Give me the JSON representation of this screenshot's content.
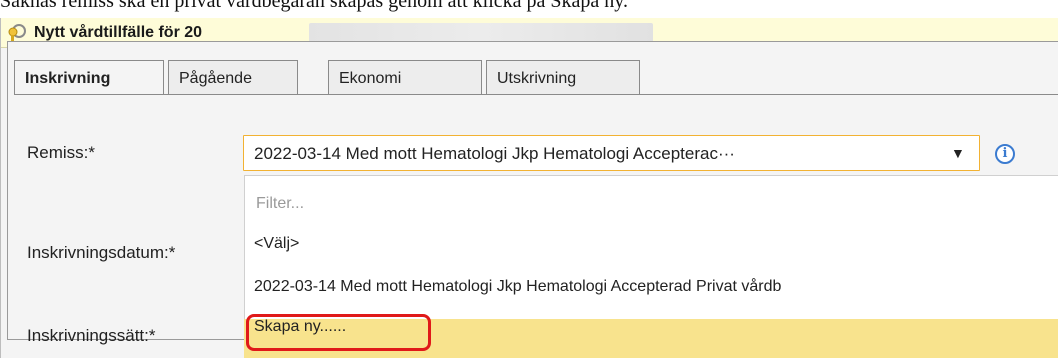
{
  "caption": "Saknas remiss ska en privat vårdbegäran skapas genom att klicka på Skapa ny.",
  "window": {
    "title": "Nytt vårdtillfälle för 20"
  },
  "tabs": [
    {
      "label": "Inskrivning",
      "active": true
    },
    {
      "label": "Pågående",
      "active": false
    },
    {
      "label": "Ekonomi",
      "active": false
    },
    {
      "label": "Utskrivning",
      "active": false
    }
  ],
  "form": {
    "remiss_label": "Remiss:*",
    "remiss_value": "2022-03-14 Med mott Hematologi Jkp Hematologi Accepterac···",
    "inskrivningsdatum_label": "Inskrivningsdatum:*",
    "inskrivningssatt_label": "Inskrivningssätt:*"
  },
  "dropdown": {
    "filter_placeholder": "Filter...",
    "options": [
      "<Välj>",
      "2022-03-14 Med mott Hematologi Jkp Hematologi Accepterad Privat vårdb",
      "Skapa ny......"
    ],
    "highlighted_index": 2
  },
  "colors": {
    "titlebar": "#fefcd8",
    "select_border": "#f2b233",
    "highlight": "#f8e38d",
    "callout": "#e01919",
    "info": "#3b7bd0"
  }
}
